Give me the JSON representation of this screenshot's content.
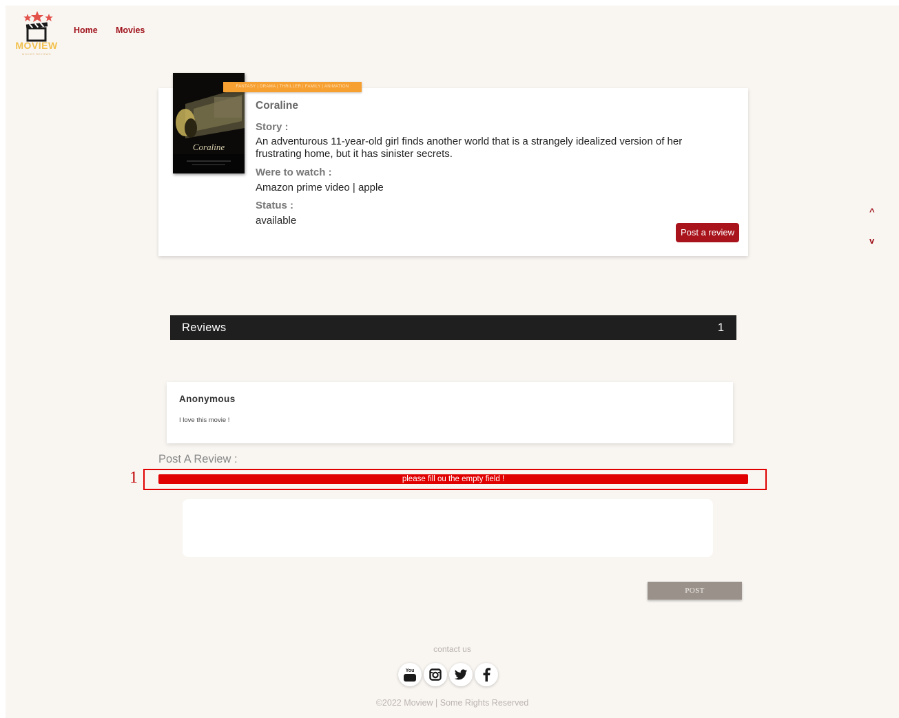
{
  "header": {
    "logo_text": "MOVIEW",
    "logo_tagline": "MOVIES REVIEWS",
    "nav": [
      {
        "label": "Home"
      },
      {
        "label": "Movies"
      }
    ]
  },
  "movie": {
    "genres": "FANTASY | DRAMA | THRILLER | FAMILY | ANIMATION",
    "title": "Coraline",
    "story_label": "Story :",
    "story": "An adventurous 11-year-old girl finds another world that is a strangely idealized version of her frustrating home, but it has sinister secrets.",
    "watch_label": "Were to watch :",
    "watch": "Amazon prime video | apple",
    "status_label": "Status :",
    "status": "available",
    "post_review_label": "Post a review",
    "poster_title": "Coraline"
  },
  "scroll": {
    "up": "^",
    "down": "v"
  },
  "reviews": {
    "heading": "Reviews",
    "count": "1",
    "items": [
      {
        "author": "Anonymous",
        "text": "I love this movie !"
      }
    ]
  },
  "post_form": {
    "heading": "Post A Review :",
    "error": "please fill ou the empty field !",
    "textarea_value": "",
    "submit_label": "POST"
  },
  "annotation": {
    "number": "1"
  },
  "footer": {
    "contact": "contact us",
    "social": [
      {
        "icon": "youtube-icon",
        "label": "You Tube"
      },
      {
        "icon": "instagram-icon"
      },
      {
        "icon": "twitter-icon"
      },
      {
        "icon": "facebook-icon"
      }
    ],
    "copyright": "©2022 Moview | Some Rights Reserved"
  },
  "colors": {
    "page_background": "#f9f6f2",
    "brand_red": "#a8131c",
    "genre_orange": "#f7a032",
    "reviews_bar": "#1f1f1f",
    "error_red": "#e00000",
    "post_button": "#9a918a"
  }
}
